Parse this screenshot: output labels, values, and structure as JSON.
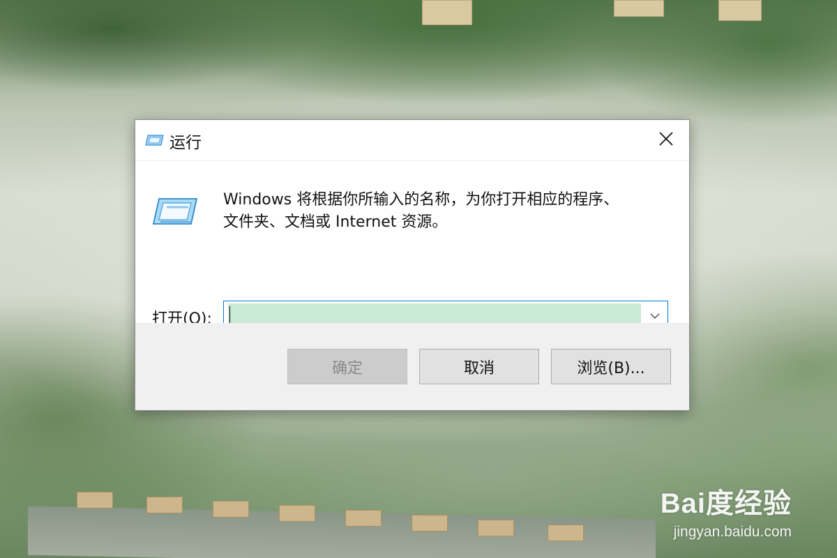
{
  "dialog": {
    "title": "运行",
    "description_line1": "Windows 将根据你所输入的名称，为你打开相应的程序、",
    "description_line2": "文件夹、文档或 Internet 资源。",
    "open_label": "打开(O):",
    "open_value": "",
    "buttons": {
      "ok": "确定",
      "cancel": "取消",
      "browse": "浏览(B)..."
    }
  },
  "icons": {
    "title": "run-icon",
    "large": "run-icon",
    "close": "close-icon",
    "dropdown": "chevron-down-icon"
  },
  "watermark": {
    "logo": "Bai度经验",
    "url": "jingyan.baidu.com"
  },
  "colors": {
    "input_highlight": "#c9ead4",
    "focus_border": "#0078d7",
    "button_bg": "#e1e1e1",
    "footer_bg": "#f0f0f0"
  }
}
